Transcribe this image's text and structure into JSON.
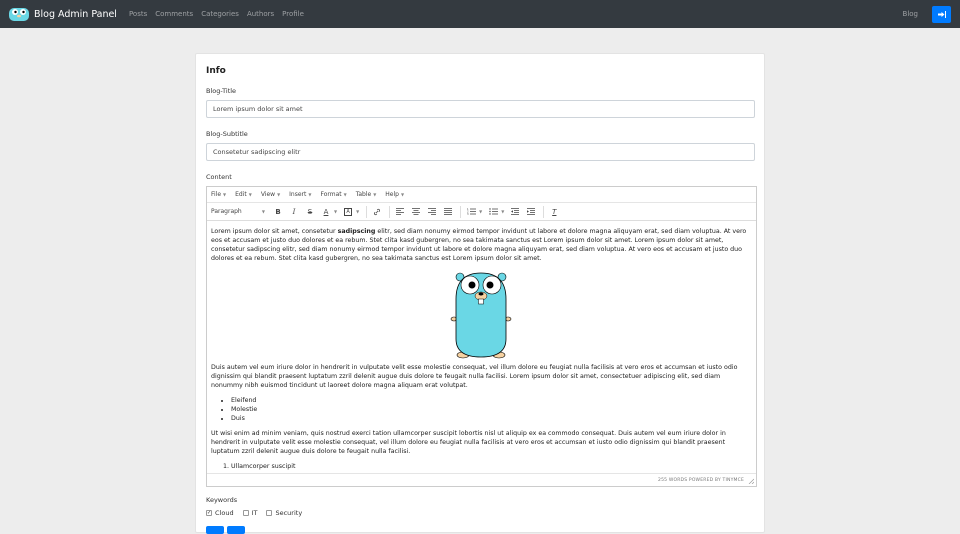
{
  "nav": {
    "brand": "Blog Admin Panel",
    "links": [
      "Posts",
      "Comments",
      "Categories",
      "Authors",
      "Profile"
    ],
    "blog": "Blog",
    "logout_icon": "sign-out-icon"
  },
  "form": {
    "title": "Info",
    "blog_title_label": "Blog-Title",
    "blog_title_value": "Lorem ipsum dolor sit amet",
    "blog_subtitle_label": "Blog-Subtitle",
    "blog_subtitle_value": "Consetetur sadipscing elitr",
    "content_label": "Content",
    "keywords_label": "Keywords"
  },
  "editor": {
    "menu": [
      "File",
      "Edit",
      "View",
      "Insert",
      "Format",
      "Table",
      "Help"
    ],
    "block_format": "Paragraph",
    "p1_a": "Lorem ipsum dolor sit amet, consetetur ",
    "p1_bold": "sadipscing",
    "p1_b": " elitr, sed diam nonumy eirmod tempor invidunt ut labore et dolore magna aliquyam erat, sed diam voluptua. At vero eos et accusam et justo duo dolores et ea rebum. Stet clita kasd gubergren, no sea takimata sanctus est Lorem ipsum dolor sit amet. Lorem ipsum dolor sit amet, consetetur sadipscing elitr, sed diam nonumy eirmod tempor invidunt ut labore et dolore magna aliquyam erat, sed diam voluptua. At vero eos et accusam et justo duo dolores et ea rebum. Stet clita kasd gubergren, no sea takimata sanctus est Lorem ipsum dolor sit amet.",
    "p2": "Duis autem vel eum iriure dolor in hendrerit in vulputate velit esse molestie consequat, vel illum dolore eu feugiat nulla facilisis at vero eros et accumsan et iusto odio dignissim qui blandit praesent luptatum zzril delenit augue duis dolore te feugait nulla facilisi. Lorem ipsum dolor sit amet, consectetuer adipiscing elit, sed diam nonummy nibh euismod tincidunt ut laoreet dolore magna aliquam erat volutpat.",
    "bullets": [
      "Eleifend",
      "Molestie",
      "Duis"
    ],
    "p3": "Ut wisi enim ad minim veniam, quis nostrud exerci tation ullamcorper suscipit lobortis nisl ut aliquip ex ea commodo consequat. Duis autem vel eum iriure dolor in hendrerit in vulputate velit esse molestie consequat, vel illum dolore eu feugiat nulla facilisis at vero eros et accumsan et iusto odio dignissim qui blandit praesent luptatum zzril delenit augue duis dolore te feugait nulla facilisi.",
    "ordered": [
      "Ullamcorper suscipit"
    ],
    "status": "255 WORDS POWERED BY TINYMCE"
  },
  "keywords": [
    {
      "label": "Cloud",
      "checked": true
    },
    {
      "label": "IT",
      "checked": false
    },
    {
      "label": "Security",
      "checked": false
    }
  ],
  "colors": {
    "navbar": "#343a40",
    "primary": "#007bff",
    "gopher": "#6AD7E5"
  }
}
